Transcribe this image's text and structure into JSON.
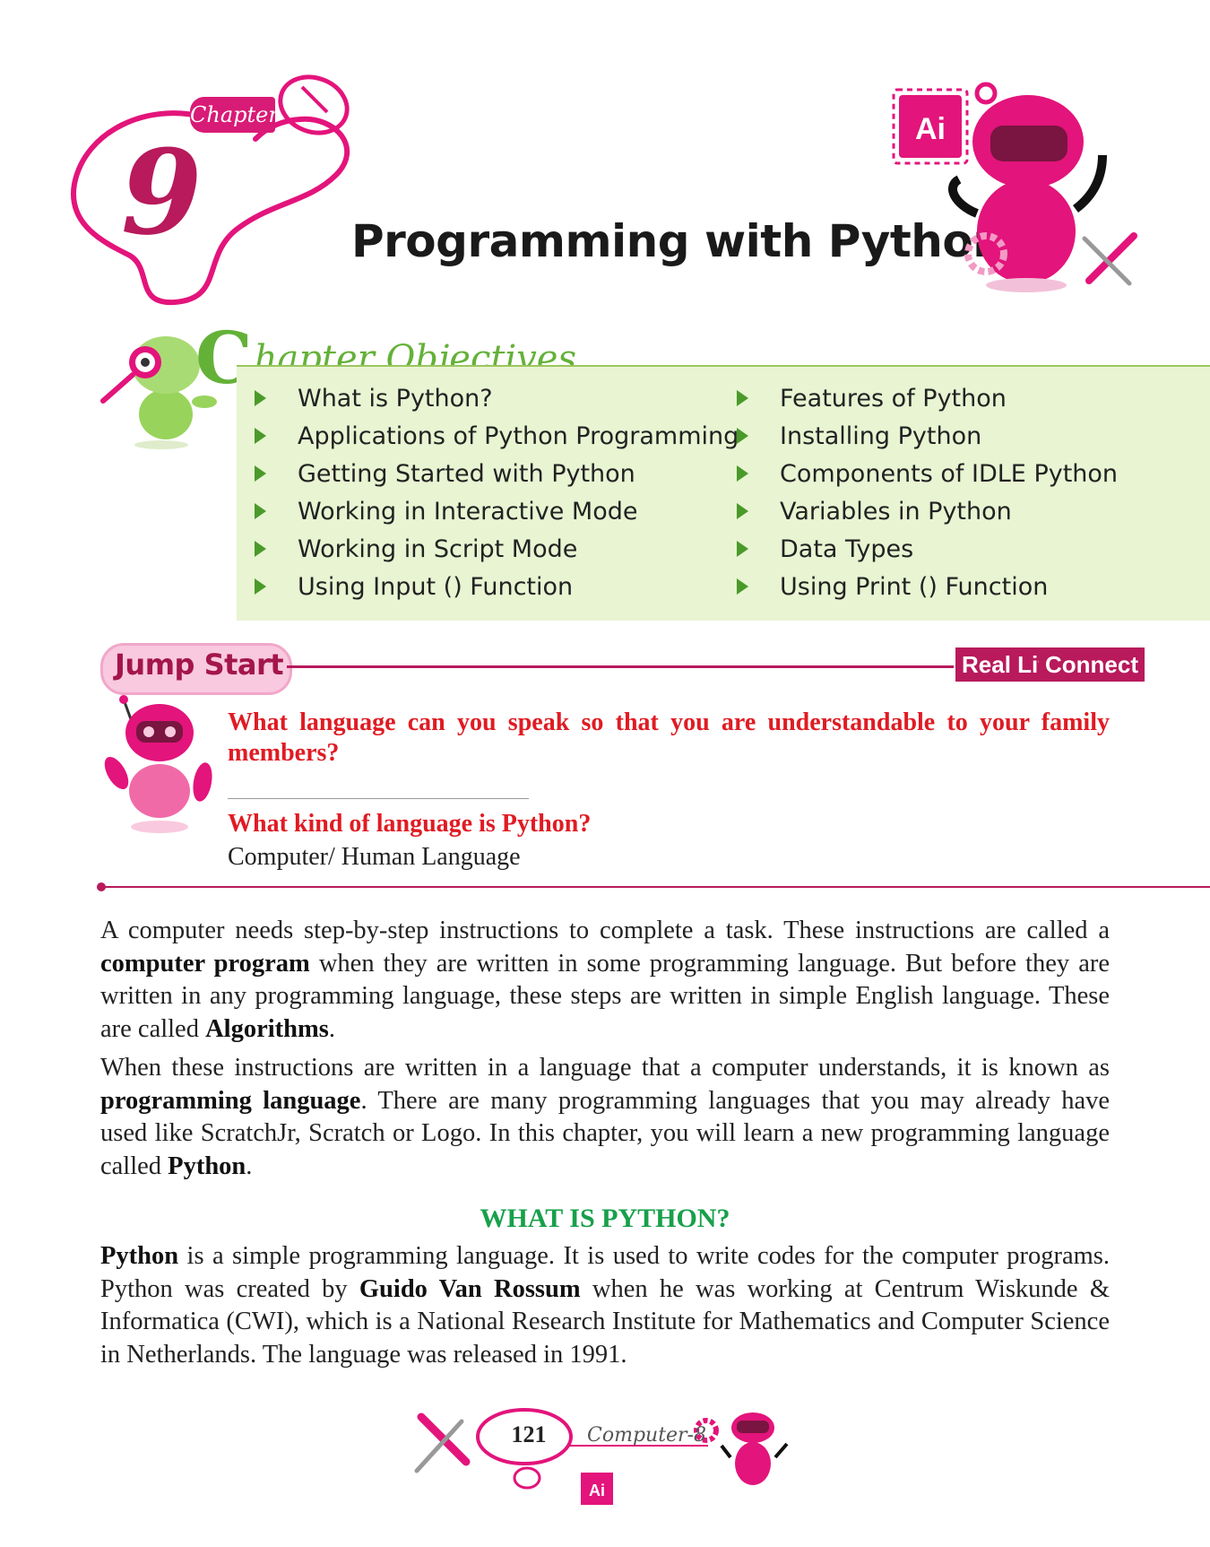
{
  "header": {
    "chapter_label": "Chapter",
    "chapter_number": "9",
    "title": "Programming with Python",
    "badge_text": "Ai"
  },
  "objectives": {
    "heading_initial": "C",
    "heading_rest": "hapter Objectives",
    "left": [
      "What is Python?",
      "Applications of Python Programming",
      "Getting Started with Python",
      "Working in Interactive Mode",
      "Working in Script Mode",
      "Using Input () Function"
    ],
    "right": [
      "Features of Python",
      "Installing Python",
      "Components of IDLE Python",
      "Variables in Python",
      "Data Types",
      "Using Print () Function"
    ]
  },
  "jump_start": {
    "label": "Jump Start",
    "tag_real_life": "Real Life",
    "tag_connect": "Connect",
    "question_1_line1": "What language can you speak so that you are understandable to your family",
    "question_1_line2": "members?",
    "question_2": "What kind of language is Python?",
    "answer_2": "Computer/ Human Language"
  },
  "body": {
    "p1_a": "A computer needs step-by-step instructions to complete a task. These instructions are called a ",
    "p1_b": "computer program",
    "p1_c": " when they are written in some programming language. But before they are written in any programming language, these steps are written in simple English language. These are called ",
    "p1_d": "Algorithms",
    "p1_e": ".",
    "p2_a": "When these instructions are written in a language that a computer understands, it is known as ",
    "p2_b": "programming language",
    "p2_c": ". There are many programming languages that you may already have used like ScratchJr, Scratch or Logo. In this chapter, you will learn a new programming language called ",
    "p2_d": "Python",
    "p2_e": ".",
    "heading": "WHAT IS PYTHON?",
    "p3_a": "Python",
    "p3_b": " is a simple programming language. It is used to write codes for the computer programs. Python was created by ",
    "p3_c": "Guido Van Rossum",
    "p3_d": " when he was working at Centrum Wiskunde & Informatica (CWI), which is a National Research Institute for Mathematics and Computer Science in Netherlands. The language was released in 1991."
  },
  "footer": {
    "page_number": "121",
    "book": "Computer-8",
    "badge_text": "Ai"
  }
}
